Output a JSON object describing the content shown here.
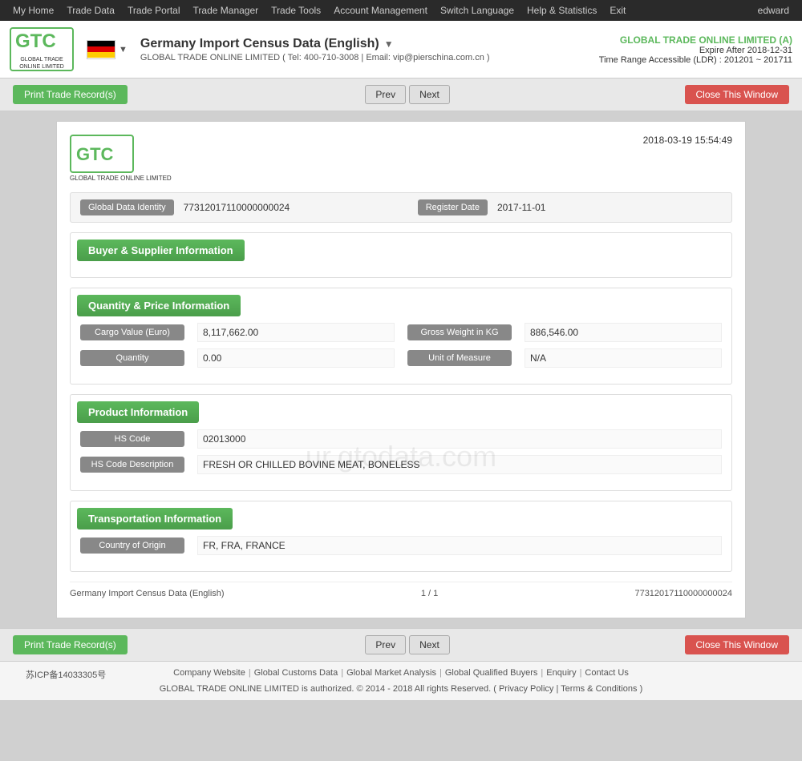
{
  "topnav": {
    "items": [
      "My Home",
      "Trade Data",
      "Trade Portal",
      "Trade Manager",
      "Trade Tools",
      "Account Management",
      "Switch Language",
      "Help & Statistics",
      "Exit"
    ],
    "user": "edward"
  },
  "header": {
    "logo_gto": "GTC",
    "logo_sub": "GLOBAL TRADE\nONLINE LIMITED",
    "title": "Germany Import Census Data (English)",
    "title_sub": "GLOBAL TRADE ONLINE LIMITED ( Tel: 400-710-3008 | Email: vip@pierschina.com.cn )",
    "company_name": "GLOBAL TRADE ONLINE LIMITED (A)",
    "expire": "Expire After 2018-12-31",
    "time_range": "Time Range Accessible (LDR) : 201201 ~ 201711"
  },
  "actions": {
    "print_label": "Print Trade Record(s)",
    "prev_label": "Prev",
    "next_label": "Next",
    "close_label": "Close This Window"
  },
  "record": {
    "timestamp": "2018-03-19 15:54:49",
    "global_data_identity_label": "Global Data Identity",
    "global_data_identity_value": "77312017110000000024",
    "register_date_label": "Register Date",
    "register_date_value": "2017-11-01",
    "sections": {
      "buyer_supplier": {
        "title": "Buyer & Supplier Information",
        "fields": []
      },
      "quantity_price": {
        "title": "Quantity & Price Information",
        "rows": [
          {
            "left_label": "Cargo Value (Euro)",
            "left_value": "8,117,662.00",
            "right_label": "Gross Weight in KG",
            "right_value": "886,546.00"
          },
          {
            "left_label": "Quantity",
            "left_value": "0.00",
            "right_label": "Unit of Measure",
            "right_value": "N/A"
          }
        ]
      },
      "product": {
        "title": "Product Information",
        "rows": [
          {
            "label": "HS Code",
            "value": "02013000"
          },
          {
            "label": "HS Code Description",
            "value": "FRESH OR CHILLED BOVINE MEAT, BONELESS"
          }
        ]
      },
      "transportation": {
        "title": "Transportation Information",
        "rows": [
          {
            "label": "Country of Origin",
            "value": "FR, FRA, FRANCE"
          }
        ]
      }
    },
    "footer": {
      "title": "Germany Import Census Data (English)",
      "page": "1 / 1",
      "id": "77312017110000000024"
    },
    "watermark": "ur.gtodata.com"
  },
  "footer": {
    "icp": "苏ICP备14033305号",
    "links": [
      "Company Website",
      "Global Customs Data",
      "Global Market Analysis",
      "Global Qualified Buyers",
      "Enquiry",
      "Contact Us"
    ],
    "copyright": "GLOBAL TRADE ONLINE LIMITED is authorized. © 2014 - 2018 All rights Reserved.  ( Privacy Policy | Terms & Conditions )"
  }
}
